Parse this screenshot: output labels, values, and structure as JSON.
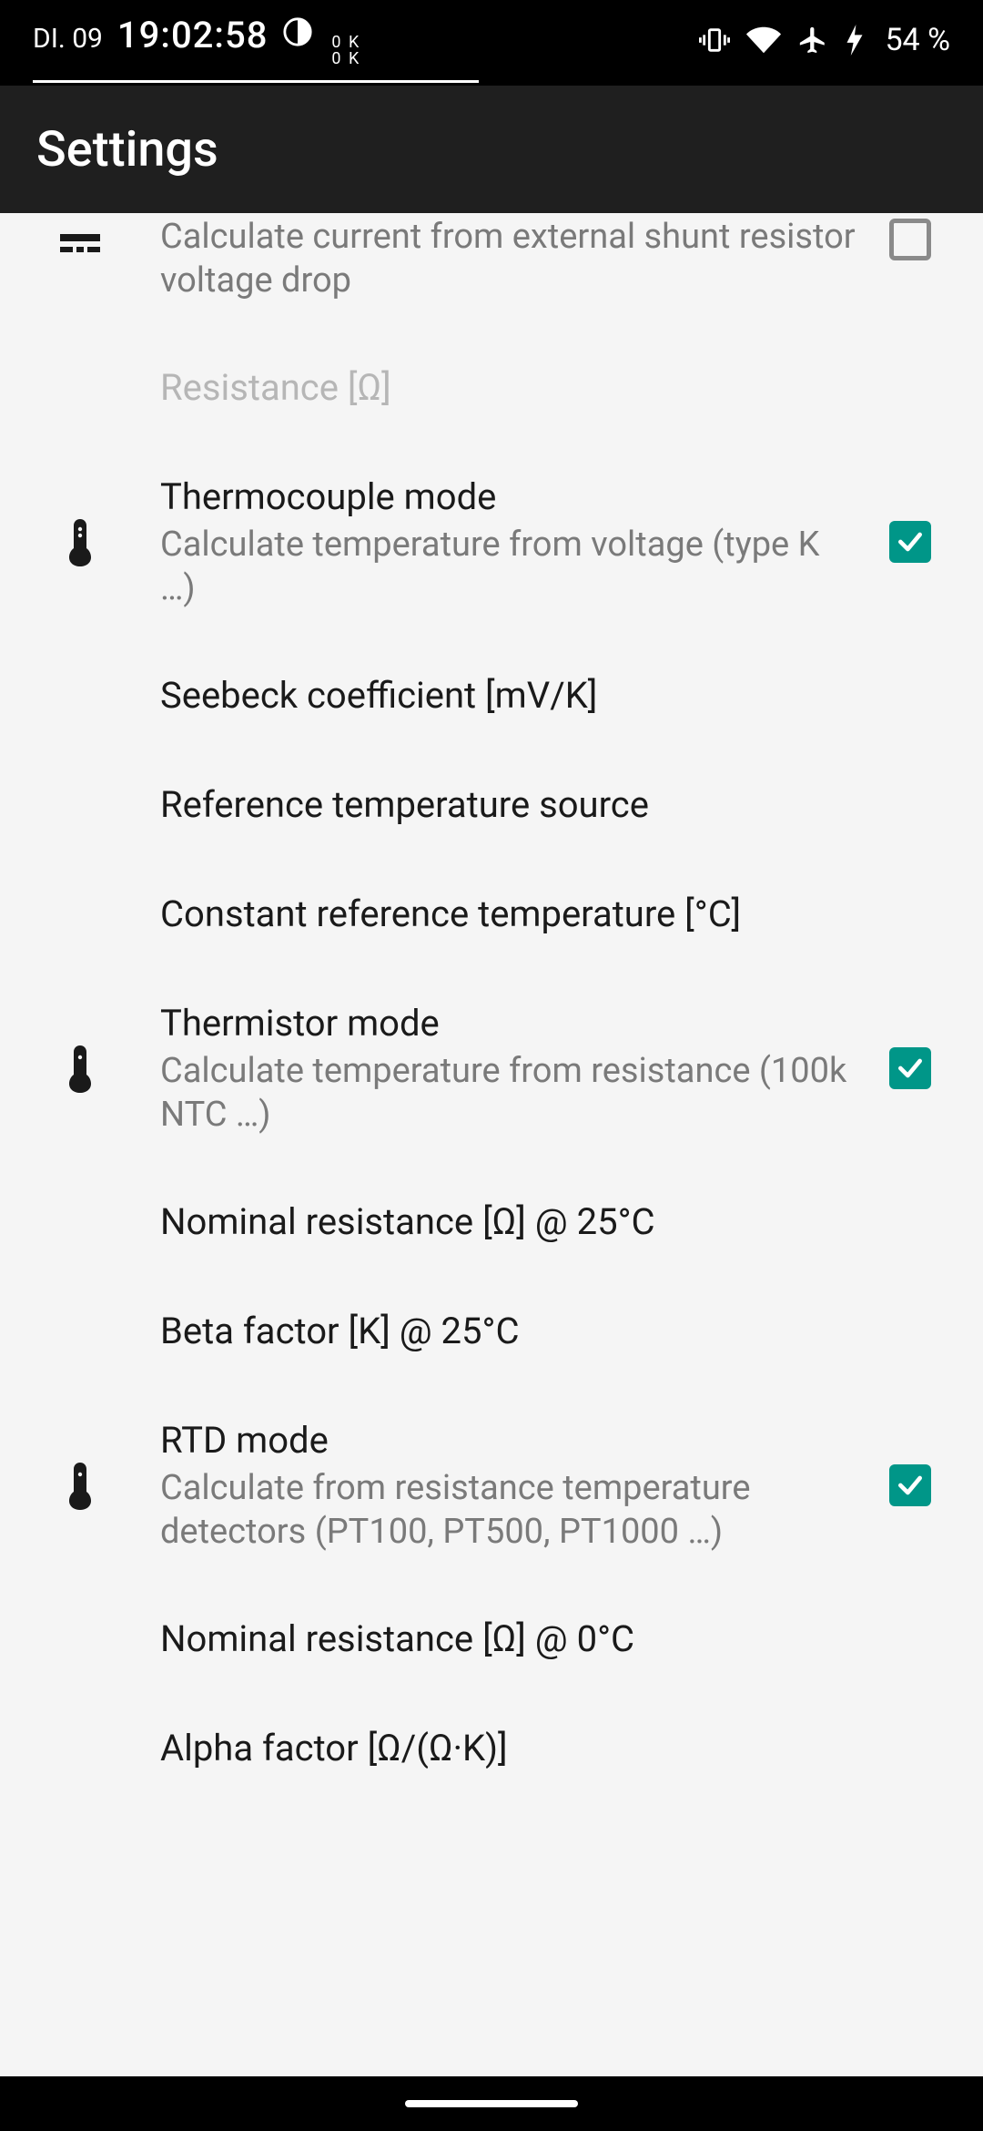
{
  "status": {
    "date": "DI. 09",
    "time": "19:02:58",
    "ok_line1": "0 K",
    "ok_line2": "0 K",
    "battery": "54 %"
  },
  "appbar": {
    "title": "Settings"
  },
  "rows": {
    "shunt": {
      "subtitle": "Calculate current from external shunt resistor voltage drop"
    },
    "resistance": {
      "title": "Resistance [Ω]"
    },
    "thermocouple": {
      "title": "Thermocouple mode",
      "subtitle": "Calculate temperature from voltage (type K …)"
    },
    "seebeck": {
      "title": "Seebeck coefficient [mV/K]"
    },
    "reftempsrc": {
      "title": "Reference temperature source"
    },
    "constreftemp": {
      "title": "Constant reference temperature [°C]"
    },
    "thermistor": {
      "title": "Thermistor mode",
      "subtitle": "Calculate temperature from resistance (100k NTC …)"
    },
    "nominal25": {
      "title": "Nominal resistance [Ω] @ 25°C"
    },
    "beta": {
      "title": "Beta factor [K] @ 25°C"
    },
    "rtd": {
      "title": "RTD mode",
      "subtitle": "Calculate from resistance temperature detectors (PT100, PT500, PT1000 …)"
    },
    "nominal0": {
      "title": "Nominal resistance [Ω] @ 0°C"
    },
    "alpha": {
      "title": "Alpha factor [Ω/(Ω·K)]"
    }
  }
}
